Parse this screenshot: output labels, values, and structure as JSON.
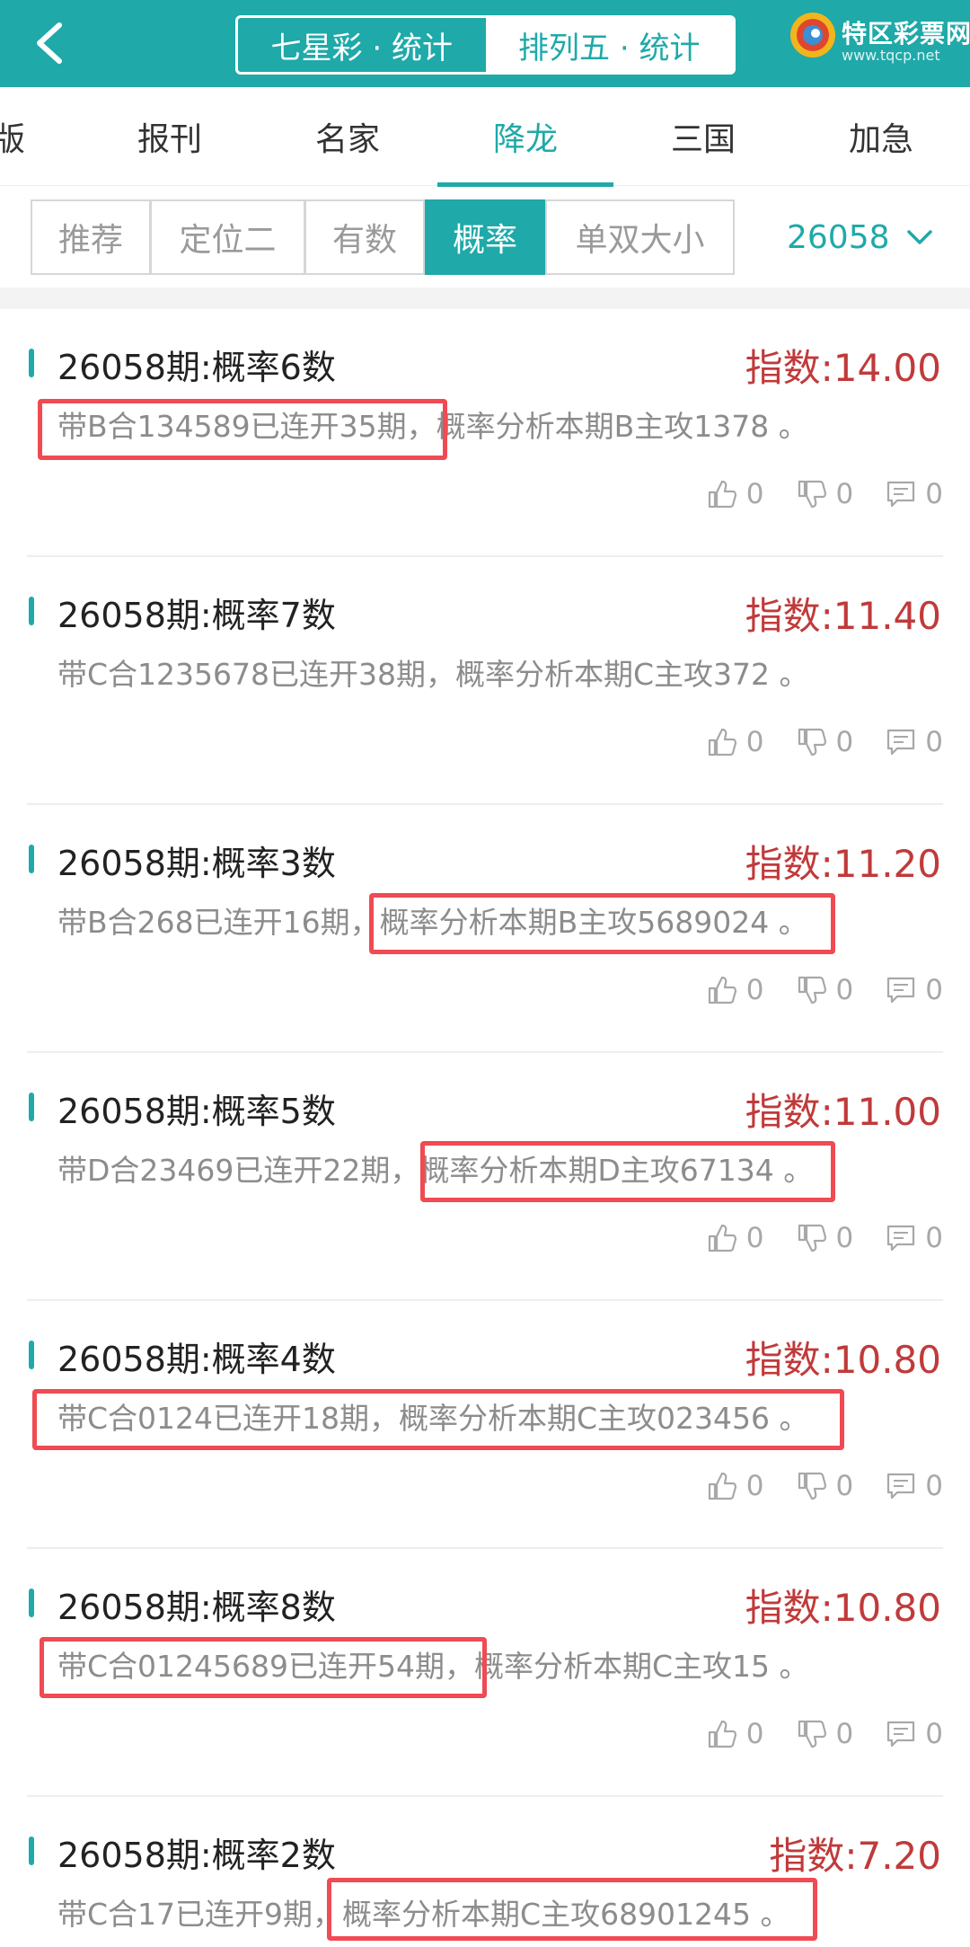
{
  "header": {
    "back_icon": "chevron-left-icon",
    "segments": [
      "七星彩 · 统计",
      "排列五 · 统计"
    ],
    "active_segment": 1,
    "logo": {
      "text": "特区彩票网",
      "url": "www.tqcp.net"
    },
    "colors": {
      "primary": "#1fa9a9",
      "accent_red": "#c03a3a",
      "highlight": "#f04a53"
    }
  },
  "tabs": [
    "版",
    "报刊",
    "名家",
    "降龙",
    "三国",
    "加急"
  ],
  "active_tab": 3,
  "filters": [
    "推荐",
    "定位二",
    "有数",
    "概率",
    "单双大小"
  ],
  "active_filter": 3,
  "issue_selector": {
    "value": "26058",
    "icon": "chevron-down-icon"
  },
  "items": [
    {
      "title": "26058期:概率6数",
      "index": "指数:14.00",
      "desc": "带B合134589已连开35期，概率分析本期B主攻1378 。",
      "likes": "0",
      "dislikes": "0",
      "comments": "0"
    },
    {
      "title": "26058期:概率7数",
      "index": "指数:11.40",
      "desc": "带C合1235678已连开38期，概率分析本期C主攻372 。",
      "likes": "0",
      "dislikes": "0",
      "comments": "0"
    },
    {
      "title": "26058期:概率3数",
      "index": "指数:11.20",
      "desc": "带B合268已连开16期，概率分析本期B主攻5689024 。",
      "likes": "0",
      "dislikes": "0",
      "comments": "0"
    },
    {
      "title": "26058期:概率5数",
      "index": "指数:11.00",
      "desc": "带D合23469已连开22期，概率分析本期D主攻67134 。",
      "likes": "0",
      "dislikes": "0",
      "comments": "0"
    },
    {
      "title": "26058期:概率4数",
      "index": "指数:10.80",
      "desc": "带C合0124已连开18期，概率分析本期C主攻023456 。",
      "likes": "0",
      "dislikes": "0",
      "comments": "0"
    },
    {
      "title": "26058期:概率8数",
      "index": "指数:10.80",
      "desc": "带C合01245689已连开54期，概率分析本期C主攻15 。",
      "likes": "0",
      "dislikes": "0",
      "comments": "0"
    },
    {
      "title": "26058期:概率2数",
      "index": "指数:7.20",
      "desc": "带C合17已连开9期，概率分析本期C主攻68901245 。",
      "likes": "0",
      "dislikes": "0",
      "comments": "0"
    }
  ]
}
